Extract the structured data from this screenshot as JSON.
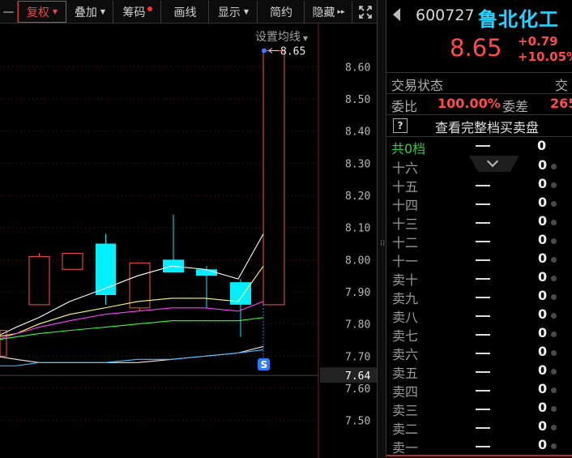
{
  "toolbar": {
    "items": [
      {
        "label": "复权",
        "dropdown": true
      },
      {
        "label": "叠加",
        "dropdown": true
      },
      {
        "label": "筹码",
        "dot": true
      },
      {
        "label": "画线"
      },
      {
        "label": "显示",
        "dropdown": true
      },
      {
        "label": "简约"
      },
      {
        "label": "隐藏",
        "arrows": "▸▸"
      }
    ],
    "fullscreen_icon": "expand-icon",
    "colors": {
      "active_border": "#d23c3c",
      "dot": "#ff3030"
    }
  },
  "chart": {
    "ma_setting_label": "设置均线",
    "price_axis_labels": [
      "8.60",
      "8.50",
      "8.40",
      "8.30",
      "8.20",
      "8.10",
      "8.00",
      "7.90",
      "7.80",
      "7.70",
      "7.60",
      "7.50"
    ],
    "current_price_label": "7.64",
    "high_marker_label": "8.65",
    "signal_badge": "S"
  },
  "chart_data": {
    "type": "candlestick",
    "ylim": [
      7.45,
      8.68
    ],
    "candles": [
      {
        "open": 7.7,
        "close": 7.78,
        "high": 7.78,
        "low": 7.7,
        "color": "red"
      },
      {
        "open": 7.86,
        "close": 8.01,
        "high": 8.02,
        "low": 7.86,
        "color": "red"
      },
      {
        "open": 7.97,
        "close": 8.02,
        "high": 8.02,
        "low": 7.97,
        "color": "red"
      },
      {
        "open": 8.05,
        "close": 7.89,
        "high": 8.08,
        "low": 7.86,
        "color": "cyan"
      },
      {
        "open": 7.85,
        "close": 7.99,
        "high": 7.99,
        "low": 7.84,
        "color": "red"
      },
      {
        "open": 8.0,
        "close": 7.96,
        "high": 8.14,
        "low": 7.96,
        "color": "cyan"
      },
      {
        "open": 7.97,
        "close": 7.95,
        "high": 7.98,
        "low": 7.85,
        "color": "cyan"
      },
      {
        "open": 7.93,
        "close": 7.86,
        "high": 7.94,
        "low": 7.76,
        "color": "cyan"
      },
      {
        "open": 7.86,
        "close": 8.65,
        "high": 8.65,
        "low": 7.86,
        "color": "red"
      }
    ],
    "moving_averages": [
      {
        "color": "#ffffff",
        "values": [
          7.76,
          7.79,
          7.82,
          7.87,
          7.91,
          7.95,
          7.98,
          7.97,
          7.94,
          8.08
        ]
      },
      {
        "color": "#ffff66",
        "values": [
          7.76,
          7.77,
          7.8,
          7.83,
          7.85,
          7.87,
          7.88,
          7.88,
          7.87,
          7.98
        ]
      },
      {
        "color": "#ff40ff",
        "values": [
          7.75,
          7.77,
          7.79,
          7.81,
          7.83,
          7.84,
          7.85,
          7.85,
          7.84,
          7.87
        ]
      },
      {
        "color": "#33ff33",
        "values": [
          7.75,
          7.76,
          7.77,
          7.78,
          7.79,
          7.8,
          7.81,
          7.81,
          7.81,
          7.82
        ]
      },
      {
        "color": "#ffe0e0",
        "values": [
          7.7,
          7.69,
          7.68,
          7.68,
          7.68,
          7.68,
          7.69,
          7.7,
          7.71,
          7.73
        ]
      },
      {
        "color": "#40c0ff",
        "values": [
          7.67,
          7.67,
          7.68,
          7.68,
          7.68,
          7.69,
          7.69,
          7.7,
          7.71,
          7.72
        ]
      }
    ]
  },
  "stock": {
    "code": "600727",
    "name": "鲁北化工",
    "price": "8.65",
    "change": "+0.79",
    "change_pct": "+10.05%"
  },
  "panel": {
    "status_label": "交易状态",
    "status_value": "交",
    "ratio_label": "委比",
    "ratio_value": "100.00%",
    "diff_label": "委差",
    "diff_value": "265",
    "book_label": "查看完整档买卖盘",
    "help_icon": "?",
    "total_label": "共0档",
    "total_count": "0"
  },
  "levels": [
    {
      "label": "十六",
      "count": "0"
    },
    {
      "label": "十五",
      "count": "0"
    },
    {
      "label": "十四",
      "count": "0"
    },
    {
      "label": "十三",
      "count": "0"
    },
    {
      "label": "十二",
      "count": "0"
    },
    {
      "label": "十一",
      "count": "0"
    },
    {
      "label": "卖十",
      "count": "0"
    },
    {
      "label": "卖九",
      "count": "0"
    },
    {
      "label": "卖八",
      "count": "0"
    },
    {
      "label": "卖七",
      "count": "0"
    },
    {
      "label": "卖六",
      "count": "0"
    },
    {
      "label": "卖五",
      "count": "0"
    },
    {
      "label": "卖四",
      "count": "0"
    },
    {
      "label": "卖三",
      "count": "0"
    },
    {
      "label": "卖二",
      "count": "0"
    },
    {
      "label": "卖一",
      "count": "0"
    }
  ]
}
